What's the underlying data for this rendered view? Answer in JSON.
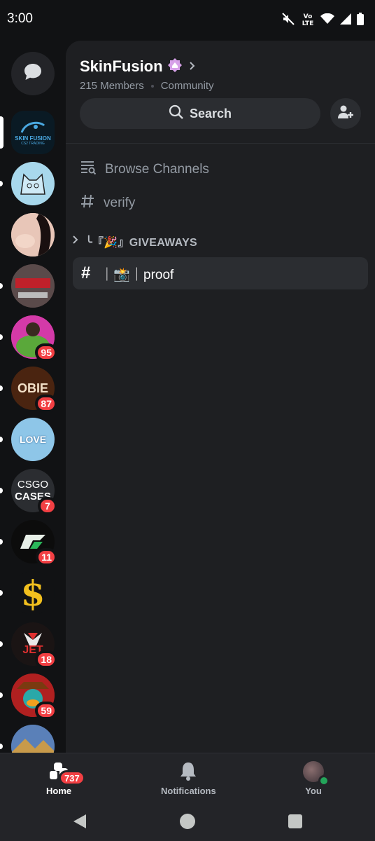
{
  "status_bar": {
    "time": "3:00",
    "network_label": "Vo LTE"
  },
  "servers": [
    {
      "name": "SkinFusion",
      "icon_text": "SKIN FUSION",
      "icon_subtext": "CS2 TRADING",
      "badge": "",
      "bg": "#0a1a24",
      "selected": true
    },
    {
      "name": "cat-server",
      "icon_text": "",
      "badge": "",
      "bg": "#a8d8ec"
    },
    {
      "name": "anime-server",
      "icon_text": "",
      "badge": "",
      "bg": "#d9b6a8"
    },
    {
      "name": "power-server",
      "icon_text": "",
      "badge": "",
      "bg": "#3a2a2a"
    },
    {
      "name": "green-server",
      "icon_text": "",
      "badge": "95",
      "bg": "#d43aa8"
    },
    {
      "name": "obie-server",
      "icon_text": "OBIE",
      "badge": "87",
      "bg": "#4a2410"
    },
    {
      "name": "love-server",
      "icon_text": "LOVE",
      "badge": "",
      "bg": "#8ec6e8"
    },
    {
      "name": "csgo-cases",
      "icon_text": "CSGO",
      "icon_subtext": "CASES",
      "badge": "7",
      "bg": "#2b2d31"
    },
    {
      "name": "arrow-server",
      "icon_text": "",
      "badge": "11",
      "bg": "#0c0c0c"
    },
    {
      "name": "dollar-server",
      "icon_text": "$",
      "badge": "",
      "bg": "#111214"
    },
    {
      "name": "jet-server",
      "icon_text": "JET",
      "badge": "18",
      "bg": "#1a1414"
    },
    {
      "name": "hat-server",
      "icon_text": "",
      "badge": "59",
      "bg": "#8a1a1a"
    },
    {
      "name": "landscape-server",
      "icon_text": "",
      "badge": "",
      "bg": "#4a6a9a"
    }
  ],
  "server_header": {
    "name": "SkinFusion",
    "members": "215 Members",
    "type": "Community"
  },
  "search": {
    "label": "Search"
  },
  "channels": {
    "browse": "Browse Channels",
    "verify": "verify",
    "category": "╰『🎉』GIVEAWAYS",
    "active": "｜📸｜proof"
  },
  "bottom_nav": {
    "home": "Home",
    "home_badge": "737",
    "notifications": "Notifications",
    "you": "You"
  },
  "colors": {
    "accent_red": "#f23f43",
    "online_green": "#23a55a",
    "nitro_pink": "#d6a1e8"
  }
}
